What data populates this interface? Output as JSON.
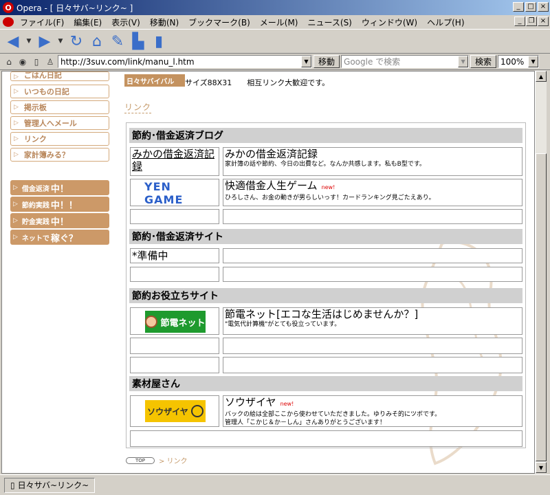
{
  "window": {
    "title": "Opera - [ 日々サバ~リンク~ ]"
  },
  "menu": {
    "items": [
      "ファイル(F)",
      "編集(E)",
      "表示(V)",
      "移動(N)",
      "ブックマーク(B)",
      "メール(M)",
      "ニュース(S)",
      "ウィンドウ(W)",
      "ヘルプ(H)"
    ]
  },
  "address": {
    "url": "http://3suv.com/link/manu_l.htm",
    "go_label": "移動",
    "search_placeholder": "Google で検索",
    "search_label": "検索",
    "zoom": "100%"
  },
  "sidebar": {
    "nav": [
      "ごはん日記",
      "いつもの日記",
      "掲示板",
      "管理人へメール",
      "リンク",
      "家計簿みる？"
    ],
    "buttons": [
      {
        "prefix": "借金返済",
        "suffix": "中！"
      },
      {
        "prefix": "節約実践",
        "suffix": "中！！"
      },
      {
        "prefix": "貯金実践",
        "suffix": "中！"
      },
      {
        "prefix": "ネットで",
        "suffix": "稼ぐ？"
      }
    ]
  },
  "header": {
    "banner": "日々サバイバル",
    "text": "サイズ88X31　　相互リンク大歓迎です。",
    "link_label": "リンク"
  },
  "sections": [
    {
      "title": "節約･借金返済ブログ",
      "rows": [
        {
          "image_text": "みかの借金返済記録",
          "title": "みかの借金返済記録",
          "new": "",
          "desc": [
            "家計簿の話や節約、今日の出費など。なんか共感します。私もB型です。"
          ]
        },
        {
          "image_text": "YEN GAME",
          "title": "快適借金人生ゲーム",
          "new": "new!",
          "desc": [
            "ひろしさん、お金の動きが男らしいっす！カードランキング見ごたえあり。"
          ]
        },
        {
          "image_text": "",
          "title": "",
          "new": "",
          "desc": []
        }
      ]
    },
    {
      "title": "節約･借金返済サイト",
      "rows": [
        {
          "image_text": "*準備中",
          "title": "",
          "new": "",
          "desc": []
        },
        {
          "image_text": "",
          "title": "",
          "new": "",
          "desc": []
        }
      ]
    },
    {
      "title": "節約お役立ちサイト",
      "rows": [
        {
          "image_text": "節電ネット",
          "title": "節電ネット[エコな生活はじめませんか？]",
          "new": "",
          "desc": [
            "\"電気代計算機\"がとても役立っています。"
          ]
        },
        {
          "image_text": "",
          "title": "",
          "new": "",
          "desc": []
        },
        {
          "image_text": "",
          "title": "",
          "new": "",
          "desc": []
        }
      ]
    },
    {
      "title": "素材屋さん",
      "rows": [
        {
          "image_text": "ソウザイヤ",
          "title": "ソウザイヤ",
          "new": "new!",
          "desc": [
            "バックの絵は全部ここから使わせていただきました。ゆりみそ的にツボです。",
            "管理人「こかじ＆か－しん」さんありがとうございます！"
          ]
        }
      ]
    }
  ],
  "footer": {
    "top_label": "TOP",
    "crumb": "> リンク"
  },
  "status": {
    "label": "日々サバ~リンク~"
  },
  "colors": {
    "accent": "#cc9968",
    "nav_text": "#b8865a",
    "new": "#dd0000",
    "section_bg": "#d0d0d0"
  }
}
